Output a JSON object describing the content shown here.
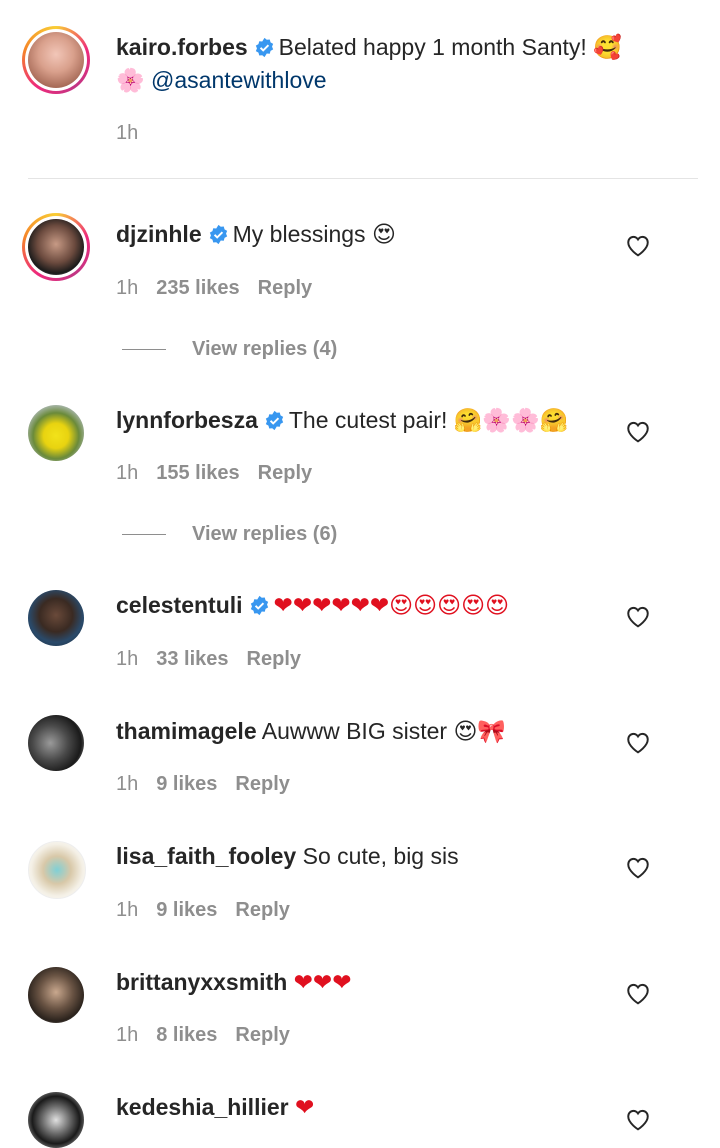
{
  "caption": {
    "username": "kairo.forbes",
    "text": "Belated happy 1 month Santy! 🥰",
    "text2": "🌸",
    "mention": "@asantewithlove",
    "time": "1h"
  },
  "comments": [
    {
      "username": "djzinhle",
      "verified": true,
      "text": "My blessings 😍",
      "time": "1h",
      "likes": "235 likes",
      "reply": "Reply",
      "view_replies": "View replies (4)"
    },
    {
      "username": "lynnforbesza",
      "verified": true,
      "text": "The cutest pair! 🤗🌸🌸🤗",
      "time": "1h",
      "likes": "155 likes",
      "reply": "Reply",
      "view_replies": "View replies (6)"
    },
    {
      "username": "celestentuli",
      "verified": true,
      "text": "❤❤❤❤❤❤😍😍😍😍😍",
      "time": "1h",
      "likes": "33 likes",
      "reply": "Reply"
    },
    {
      "username": "thamimagele",
      "verified": false,
      "text": "Auwww BIG sister 😍🎀",
      "time": "1h",
      "likes": "9 likes",
      "reply": "Reply"
    },
    {
      "username": "lisa_faith_fooley",
      "verified": false,
      "text": "So cute, big sis",
      "time": "1h",
      "likes": "9 likes",
      "reply": "Reply"
    },
    {
      "username": "brittanyxxsmith",
      "verified": false,
      "text": "❤❤❤",
      "time": "1h",
      "likes": "8 likes",
      "reply": "Reply"
    },
    {
      "username": "kedeshia_hillier",
      "verified": false,
      "text": "❤",
      "time": "",
      "likes": "",
      "reply": ""
    }
  ],
  "colors": {
    "link": "#00376b",
    "meta": "#8e8e8e",
    "verified": "#3897f0",
    "heart_red": "#e0101f"
  },
  "icons": {
    "like": "heart-outline-icon",
    "verified": "verified-badge-icon"
  }
}
